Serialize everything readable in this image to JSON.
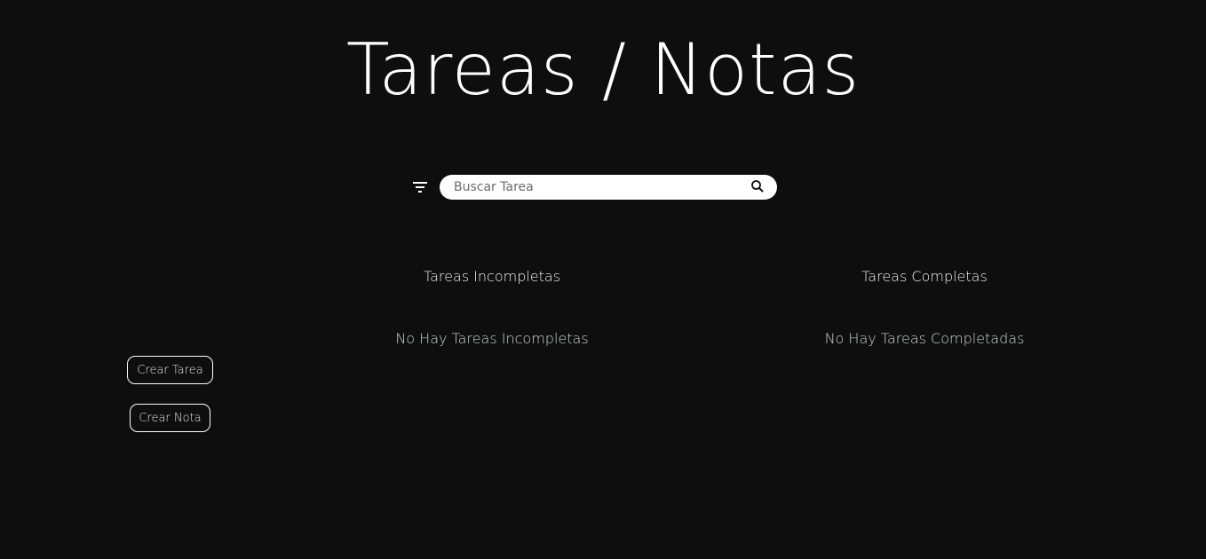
{
  "header": {
    "title": "Tareas / Notas"
  },
  "toolbar": {
    "filter_icon": "filter-icon",
    "search": {
      "placeholder": "Buscar Tarea",
      "value": "",
      "icon": "search-icon"
    }
  },
  "columns": {
    "incomplete": {
      "title": "Tareas Incompletas",
      "empty_message": "No Hay Tareas Incompletas"
    },
    "complete": {
      "title": "Tareas Completas",
      "empty_message": "No Hay Tareas Completadas"
    }
  },
  "sidebar": {
    "create_task_label": "Crear Tarea",
    "create_note_label": "Crear Nota"
  },
  "colors": {
    "background": "#0e0e0e",
    "text": "#ffffff",
    "search_bg": "#ffffff",
    "empty_text": "#c9d6cf"
  }
}
